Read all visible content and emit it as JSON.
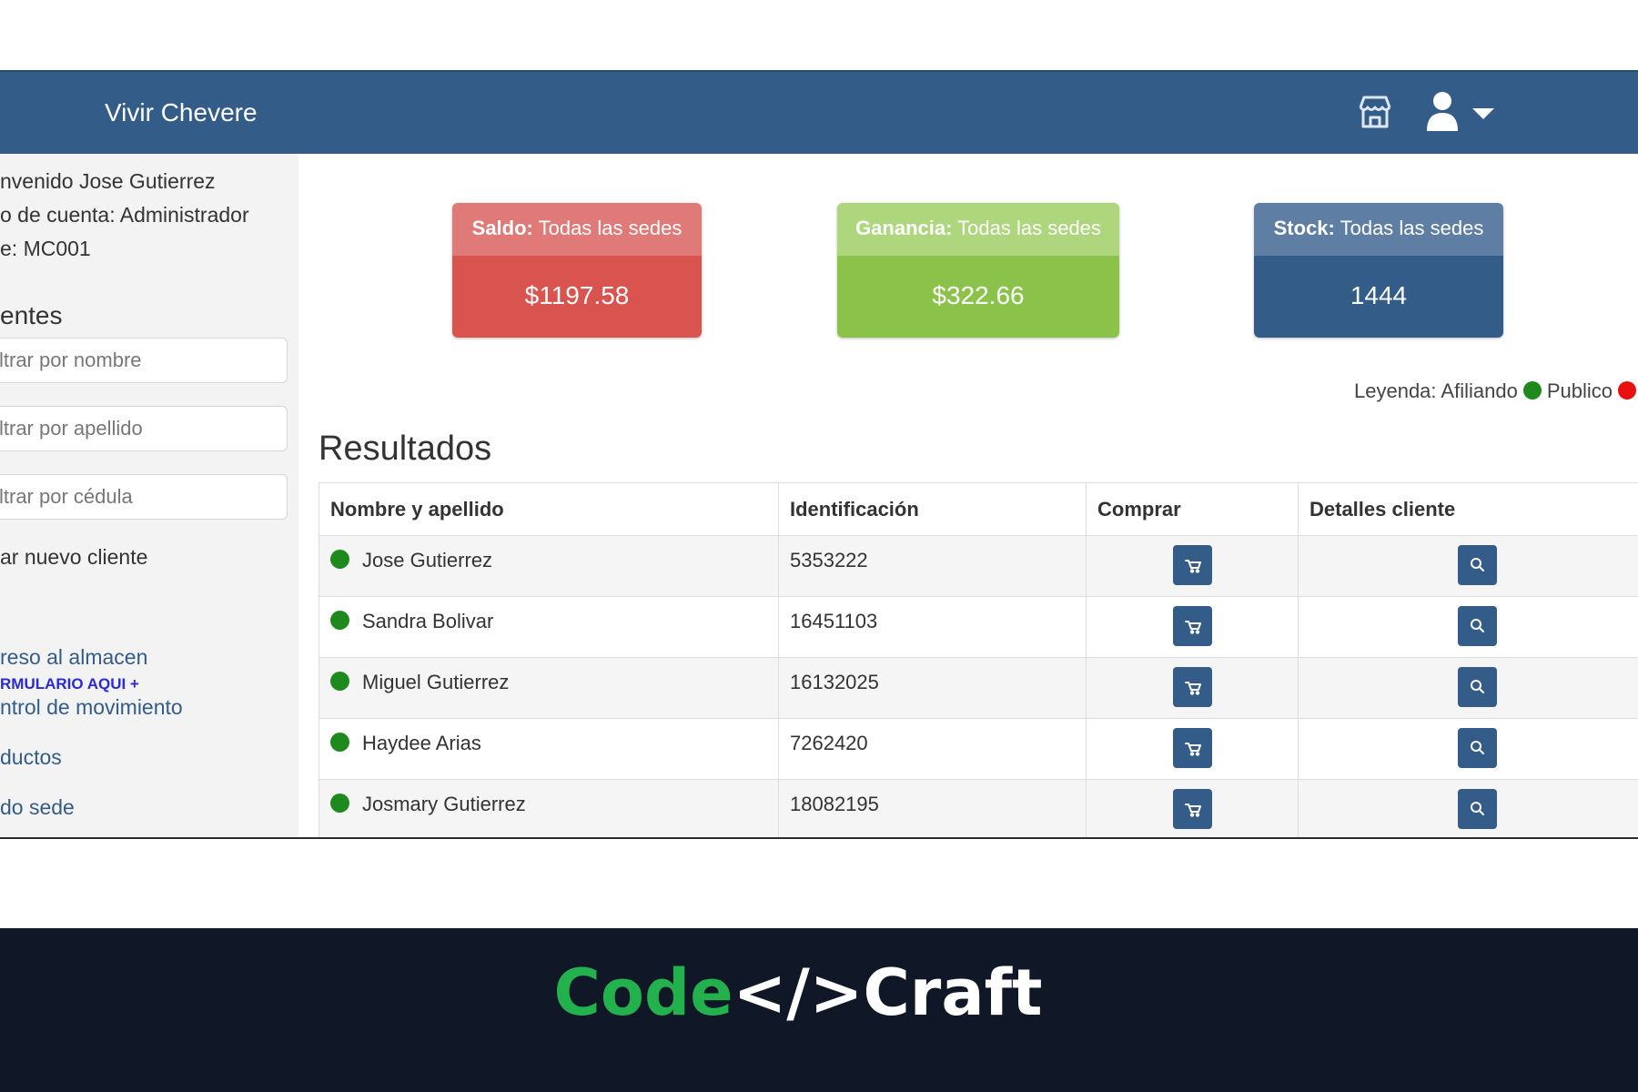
{
  "navbar": {
    "brand": "Vivir Chevere",
    "icons": [
      "store-icon",
      "user-icon",
      "caret-down-icon"
    ]
  },
  "sidebar": {
    "welcome": "nvenido Jose Gutierrez",
    "account_type": "o de cuenta: Administrador",
    "sede": "e: MC001",
    "clients_heading": "entes",
    "filter_name_placeholder": "ltrar por nombre",
    "filter_lastname_placeholder": "ltrar por apellido",
    "filter_id_placeholder": "ltrar por cédula",
    "new_client": "ar nuevo cliente",
    "form_link": "RMULARIO AQUI +",
    "links": [
      "reso al almacen",
      "ntrol de movimiento",
      "ductos",
      "do sede"
    ]
  },
  "cards": [
    {
      "label": "Saldo:",
      "scope": "Todas las sedes",
      "value": "$1197.58",
      "head_color": "#e07a78",
      "body_color": "#d9534f"
    },
    {
      "label": "Ganancia:",
      "scope": "Todas las sedes",
      "value": "$322.66",
      "head_color": "#aed67c",
      "body_color": "#8bc34a"
    },
    {
      "label": "Stock:",
      "scope": "Todas las sedes",
      "value": "1444",
      "head_color": "#5e7fa3",
      "body_color": "#345c88"
    }
  ],
  "legend": {
    "label": "Leyenda: Afiliando",
    "public_label": "Publico",
    "afiliando_color": "#1e8a1e",
    "publico_color": "#e81010"
  },
  "results": {
    "title": "Resultados",
    "columns": [
      "Nombre y apellido",
      "Identificación",
      "Comprar",
      "Detalles cliente"
    ],
    "rows": [
      {
        "name": "Jose Gutierrez",
        "id": "5353222"
      },
      {
        "name": "Sandra Bolivar",
        "id": "16451103"
      },
      {
        "name": "Miguel Gutierrez",
        "id": "16132025"
      },
      {
        "name": "Haydee Arias",
        "id": "7262420"
      },
      {
        "name": "Josmary Gutierrez",
        "id": "18082195"
      }
    ],
    "buy_icon": "cart-icon",
    "details_icon": "magnifier-icon"
  },
  "footer": {
    "logo_code": "Code",
    "logo_tag": "</>",
    "logo_craft": "Craft",
    "code_color": "#22b14c",
    "craft_color": "#ffffff"
  }
}
